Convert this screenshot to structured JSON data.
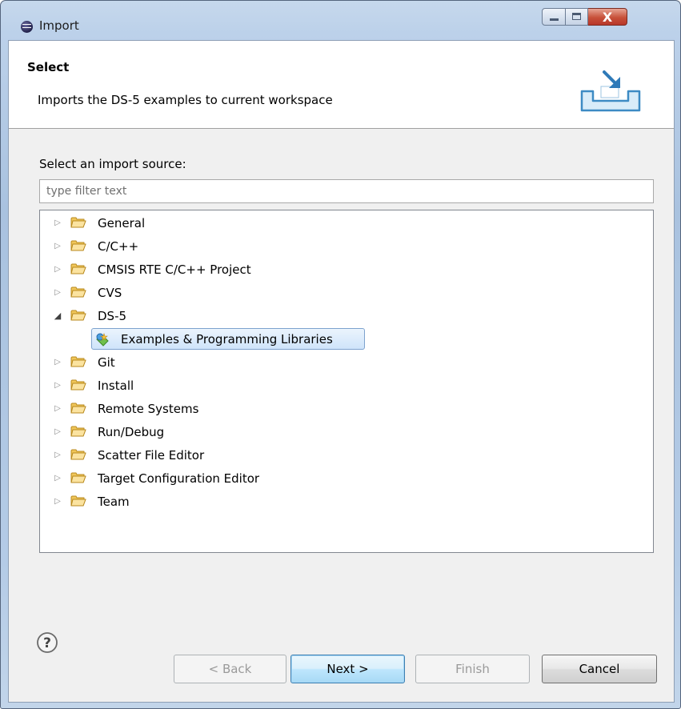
{
  "window": {
    "title": "Import",
    "icon": "eclipse-icon",
    "controls": {
      "minimize": "minimize-icon",
      "maximize": "maximize-icon",
      "close_glyph": "X"
    }
  },
  "header": {
    "title": "Select",
    "description": "Imports the DS-5 examples to current workspace",
    "graphic": "import-wizard-icon"
  },
  "source": {
    "label": "Select an import source:",
    "filter_placeholder": "type filter text",
    "filter_value": ""
  },
  "tree": {
    "items": [
      {
        "label": "General",
        "expanded": false,
        "icon": "folder-icon"
      },
      {
        "label": "C/C++",
        "expanded": false,
        "icon": "folder-icon"
      },
      {
        "label": "CMSIS RTE C/C++ Project",
        "expanded": false,
        "icon": "folder-icon"
      },
      {
        "label": "CVS",
        "expanded": false,
        "icon": "folder-icon"
      },
      {
        "label": "DS-5",
        "expanded": true,
        "icon": "folder-icon",
        "children": [
          {
            "label": "Examples & Programming Libraries",
            "selected": true,
            "icon": "examples-wizard-icon"
          }
        ]
      },
      {
        "label": "Git",
        "expanded": false,
        "icon": "folder-icon"
      },
      {
        "label": "Install",
        "expanded": false,
        "icon": "folder-icon"
      },
      {
        "label": "Remote Systems",
        "expanded": false,
        "icon": "folder-icon"
      },
      {
        "label": "Run/Debug",
        "expanded": false,
        "icon": "folder-icon"
      },
      {
        "label": "Scatter File Editor",
        "expanded": false,
        "icon": "folder-icon"
      },
      {
        "label": "Target Configuration Editor",
        "expanded": false,
        "icon": "folder-icon"
      },
      {
        "label": "Team",
        "expanded": false,
        "icon": "folder-icon"
      }
    ]
  },
  "buttons": {
    "help_icon": "help-icon",
    "back": {
      "label": "< Back",
      "enabled": false
    },
    "next": {
      "label": "Next >",
      "enabled": true,
      "default": true
    },
    "finish": {
      "label": "Finish",
      "enabled": false
    },
    "cancel": {
      "label": "Cancel",
      "enabled": true
    }
  },
  "colors": {
    "selection_border": "#7da2ce",
    "selection_fill": "#cfe4fa",
    "folder": "#f0c65a",
    "default_button": "#3c7fb1"
  }
}
